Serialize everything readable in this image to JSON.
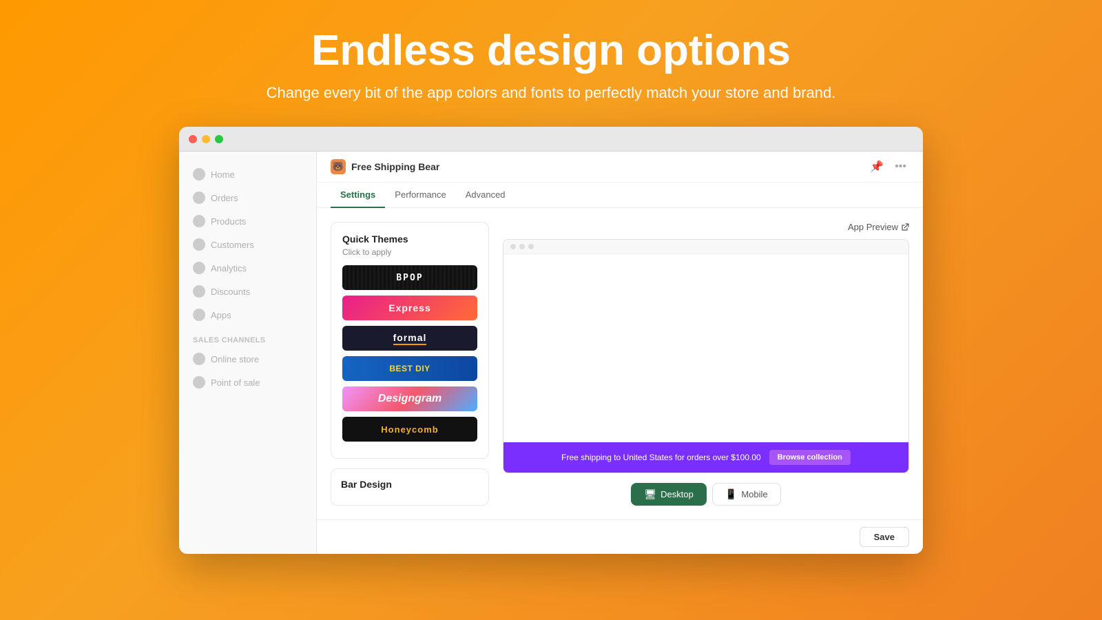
{
  "hero": {
    "title": "Endless design options",
    "subtitle": "Change every bit of the app colors and fonts to perfectly match your store and brand."
  },
  "browser": {
    "dots": [
      "red",
      "yellow",
      "green"
    ]
  },
  "sidebar": {
    "items": [
      {
        "label": "Home"
      },
      {
        "label": "Orders"
      },
      {
        "label": "Products"
      },
      {
        "label": "Customers"
      },
      {
        "label": "Analytics"
      },
      {
        "label": "Discounts"
      },
      {
        "label": "Apps"
      }
    ],
    "section_label": "SALES CHANNELS",
    "section_items": [
      {
        "label": "Online store"
      },
      {
        "label": "Point of sale"
      }
    ]
  },
  "app_header": {
    "icon": "🐻",
    "name": "Free Shipping Bear",
    "pin_icon": "📌",
    "more_icon": "•••"
  },
  "tabs": [
    {
      "label": "Settings",
      "active": true
    },
    {
      "label": "Performance",
      "active": false
    },
    {
      "label": "Advanced",
      "active": false
    }
  ],
  "quick_themes": {
    "title": "Quick Themes",
    "subtitle": "Click to apply",
    "themes": [
      {
        "name": "bpop",
        "label": "BPOP"
      },
      {
        "name": "express",
        "label": "Express"
      },
      {
        "name": "formal",
        "label": "formal"
      },
      {
        "name": "bestdiy",
        "label": "BEST DIY"
      },
      {
        "name": "designgram",
        "label": "Designgram"
      },
      {
        "name": "honeycomb",
        "label": "Honeycomb"
      }
    ]
  },
  "bar_design": {
    "title": "Bar Design"
  },
  "preview": {
    "app_preview_label": "App Preview",
    "shipping_bar_text": "Free shipping to United States for orders over $100.00",
    "browse_btn_label": "Browse collection"
  },
  "view_toggle": {
    "desktop_label": "Desktop",
    "mobile_label": "Mobile"
  },
  "footer": {
    "save_label": "Save"
  }
}
